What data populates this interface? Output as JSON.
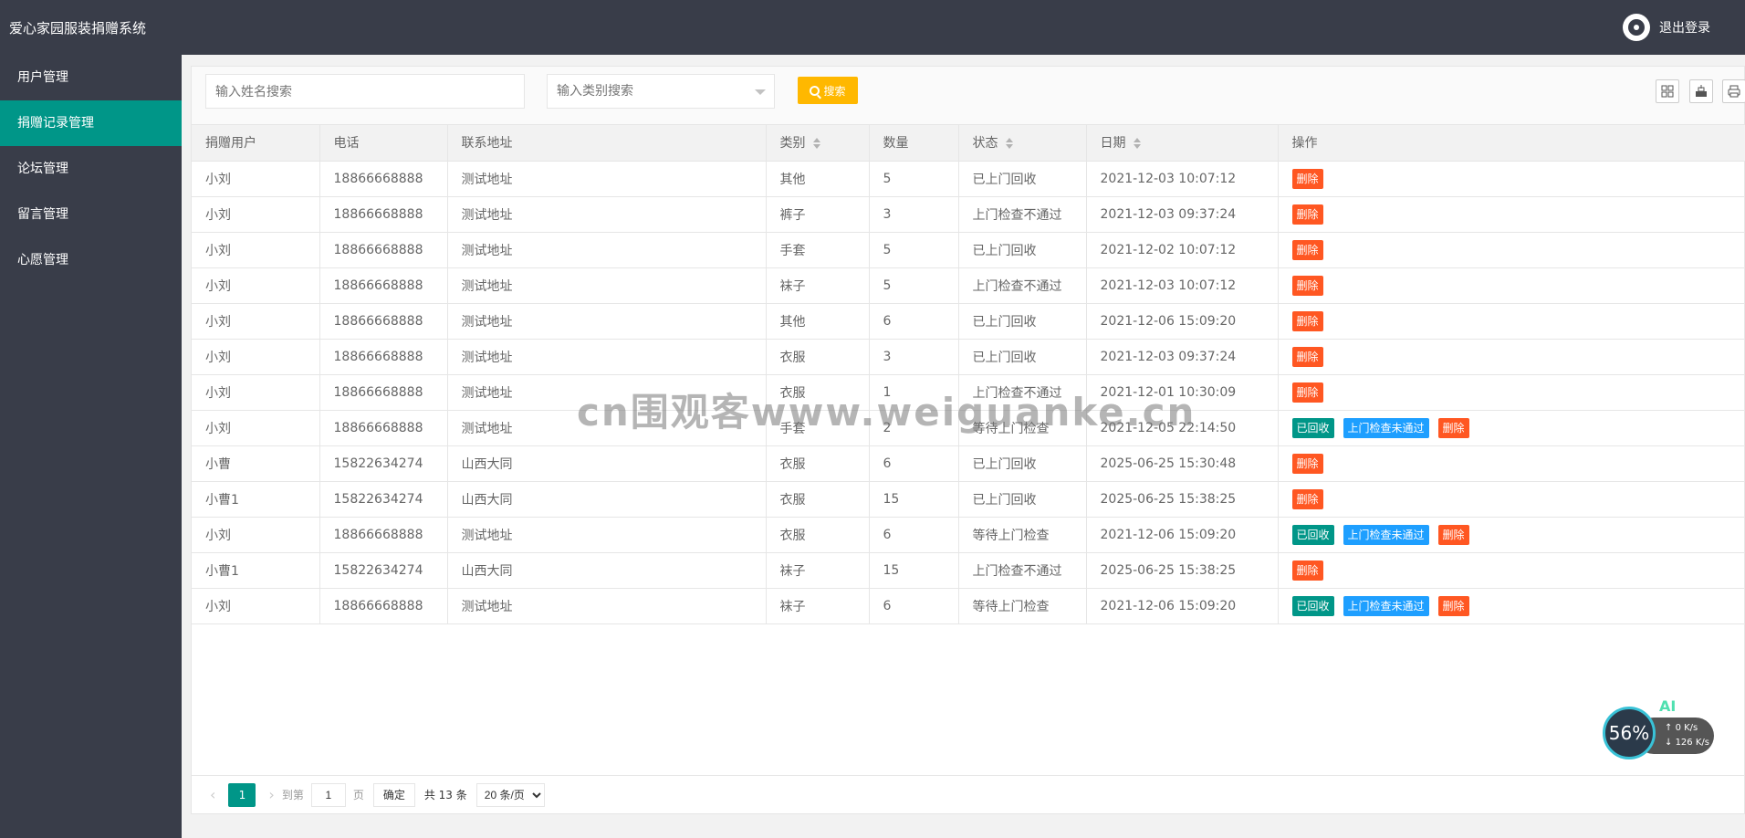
{
  "app": {
    "title": "爱心家园服装捐赠系统",
    "logout_label": "退出登录"
  },
  "sidebar": {
    "items": [
      {
        "label": "用户管理"
      },
      {
        "label": "捐赠记录管理"
      },
      {
        "label": "论坛管理"
      },
      {
        "label": "留言管理"
      },
      {
        "label": "心愿管理"
      }
    ]
  },
  "toolbar": {
    "name_placeholder": "输入姓名搜索",
    "type_placeholder": "输入类别搜索",
    "search_label": "搜索",
    "icons": [
      "grid-icon",
      "export-icon",
      "print-icon"
    ]
  },
  "table": {
    "columns": [
      "捐赠用户",
      "电话",
      "联系地址",
      "类别",
      "数量",
      "状态",
      "日期",
      "操作"
    ],
    "rows": [
      {
        "user": "小刘",
        "phone": "18866668888",
        "address": "测试地址",
        "category": "其他",
        "qty": "5",
        "status": "已上门回收",
        "status_alert": false,
        "date": "2021-12-03 10:07:12",
        "pending": false
      },
      {
        "user": "小刘",
        "phone": "18866668888",
        "address": "测试地址",
        "category": "裤子",
        "qty": "3",
        "status": "上门检查不通过",
        "status_alert": true,
        "date": "2021-12-03 09:37:24",
        "pending": false
      },
      {
        "user": "小刘",
        "phone": "18866668888",
        "address": "测试地址",
        "category": "手套",
        "qty": "5",
        "status": "已上门回收",
        "status_alert": false,
        "date": "2021-12-02 10:07:12",
        "pending": false
      },
      {
        "user": "小刘",
        "phone": "18866668888",
        "address": "测试地址",
        "category": "袜子",
        "qty": "5",
        "status": "上门检查不通过",
        "status_alert": true,
        "date": "2021-12-03 10:07:12",
        "pending": false
      },
      {
        "user": "小刘",
        "phone": "18866668888",
        "address": "测试地址",
        "category": "其他",
        "qty": "6",
        "status": "已上门回收",
        "status_alert": false,
        "date": "2021-12-06 15:09:20",
        "pending": false
      },
      {
        "user": "小刘",
        "phone": "18866668888",
        "address": "测试地址",
        "category": "衣服",
        "qty": "3",
        "status": "已上门回收",
        "status_alert": false,
        "date": "2021-12-03 09:37:24",
        "pending": false
      },
      {
        "user": "小刘",
        "phone": "18866668888",
        "address": "测试地址",
        "category": "衣服",
        "qty": "1",
        "status": "上门检查不通过",
        "status_alert": true,
        "date": "2021-12-01 10:30:09",
        "pending": false
      },
      {
        "user": "小刘",
        "phone": "18866668888",
        "address": "测试地址",
        "category": "手套",
        "qty": "2",
        "status": "等待上门检查",
        "status_alert": false,
        "date": "2021-12-05 22:14:50",
        "pending": true
      },
      {
        "user": "小曹",
        "phone": "15822634274",
        "address": "山西大同",
        "category": "衣服",
        "qty": "6",
        "status": "已上门回收",
        "status_alert": false,
        "date": "2025-06-25 15:30:48",
        "pending": false
      },
      {
        "user": "小曹1",
        "phone": "15822634274",
        "address": "山西大同",
        "category": "衣服",
        "qty": "15",
        "status": "已上门回收",
        "status_alert": false,
        "date": "2025-06-25 15:38:25",
        "pending": false
      },
      {
        "user": "小刘",
        "phone": "18866668888",
        "address": "测试地址",
        "category": "衣服",
        "qty": "6",
        "status": "等待上门检查",
        "status_alert": false,
        "date": "2021-12-06 15:09:20",
        "pending": true
      },
      {
        "user": "小曹1",
        "phone": "15822634274",
        "address": "山西大同",
        "category": "袜子",
        "qty": "15",
        "status": "上门检查不通过",
        "status_alert": true,
        "date": "2025-06-25 15:38:25",
        "pending": false
      },
      {
        "user": "小刘",
        "phone": "18866668888",
        "address": "测试地址",
        "category": "袜子",
        "qty": "6",
        "status": "等待上门检查",
        "status_alert": false,
        "date": "2021-12-06 15:09:20",
        "pending": true
      }
    ],
    "actions": {
      "recycled_label": "已回收",
      "fail_label": "上门检查未通过",
      "delete_label": "删除"
    }
  },
  "pager": {
    "current_page": "1",
    "goto_label": "到第",
    "page_input_value": "1",
    "page_suffix": "页",
    "confirm_label": "确定",
    "total_label": "共 13 条",
    "limit_label": "20 条/页"
  },
  "overlays": {
    "watermark": "cn围观客www.weiguanke.cn",
    "speed_percent": "56%",
    "speed_up": "0 K/s",
    "speed_down": "126 K/s",
    "ai_label": "AI"
  },
  "colors": {
    "topbar": "#393d49",
    "active_nav": "#009688",
    "search_btn": "#ffb800",
    "delete_btn": "#ff5722",
    "recycled_btn": "#009688",
    "fail_btn": "#1e9fff",
    "status_alert": "#ff1a1a"
  }
}
